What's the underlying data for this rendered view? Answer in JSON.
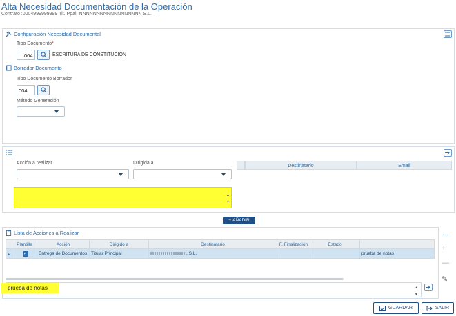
{
  "header": {
    "title": "Alta Necesidad Documentación de la Operación",
    "subtitle": "Contrato :0004999999999 Tit. Ppal: NNNNNNNNNNNNNNNNNN S.L."
  },
  "config": {
    "section_title": "Configuración Necesidad Documental",
    "tipo_documento_label": "Tipo Documento",
    "required_mark": "*",
    "tipo_documento_code": "004",
    "tipo_documento_desc": "ESCRITURA DE CONSTITUCION"
  },
  "borrador": {
    "section_title": "Borrador Documento",
    "tipo_borrador_label": "Tipo Documento Borrador",
    "tipo_borrador_code": "004",
    "metodo_label": "Método Generación"
  },
  "acciones_form": {
    "accion_label": "Acción a realizar",
    "dirigida_label": "Dirigida a",
    "dest_header": "Destinatario",
    "email_header": "Email",
    "add_button": "AÑADIR"
  },
  "lista": {
    "title": "Lista de Acciones a Realizar",
    "columns": [
      "Plantilla",
      "Acción",
      "Dirigido a",
      "Destinatario",
      "F. Finalización",
      "Estado",
      ""
    ],
    "rows": [
      {
        "accion": "Entrega de Documentos",
        "dirigido": "Titular Principal",
        "destinatario": ", S.L.",
        "finalizacion": "",
        "estado": "",
        "notas": "prueba de notas"
      }
    ],
    "notes_value": "prueba de notas"
  },
  "footer": {
    "save_label": "GUARDAR",
    "exit_label": "SALIR"
  },
  "colors": {
    "accent": "#2a6db0",
    "highlight": "#ffff33",
    "primary_button": "#1f4f86"
  }
}
